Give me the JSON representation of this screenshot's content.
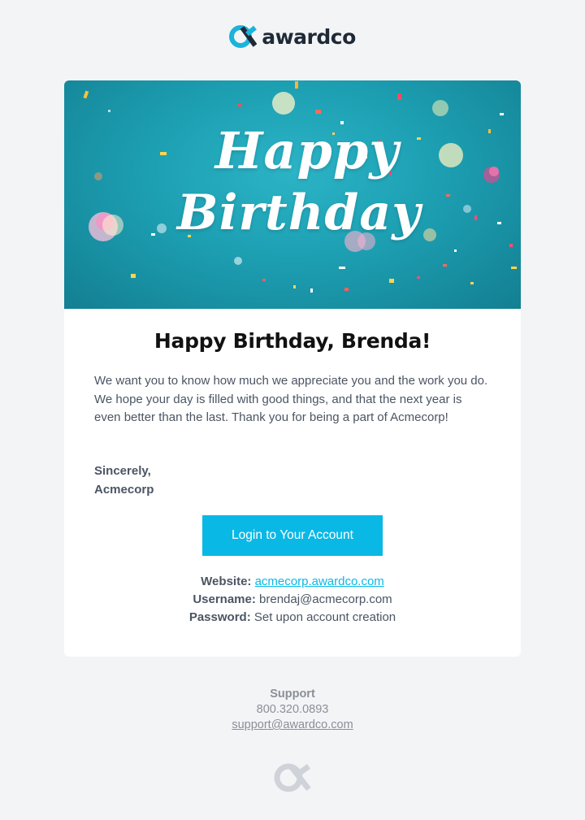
{
  "brand": {
    "name": "awardco",
    "accent_color": "#0ab8e6",
    "logo_icon": "awardco-mark-icon"
  },
  "hero": {
    "line1": "Happy",
    "line2": "Birthday",
    "background_color": "#1d9fb2"
  },
  "email": {
    "headline": "Happy Birthday, Brenda!",
    "message": "We want you to know how much we appreciate you and the work you do. We hope your day is filled with good things, and that the next year is even better than the last. Thank you for being a part of Acmecorp!",
    "signoff_line1": "Sincerely,",
    "signoff_line2": "Acmecorp",
    "button_label": "Login to Your Account"
  },
  "account": {
    "website_label": "Website:",
    "website_value": "acmecorp.awardco.com",
    "username_label": "Username:",
    "username_value": "brendaj@acmecorp.com",
    "password_label": "Password:",
    "password_value": "Set upon account creation"
  },
  "footer": {
    "title": "Support",
    "phone": "800.320.0893",
    "email": "support@awardco.com"
  }
}
